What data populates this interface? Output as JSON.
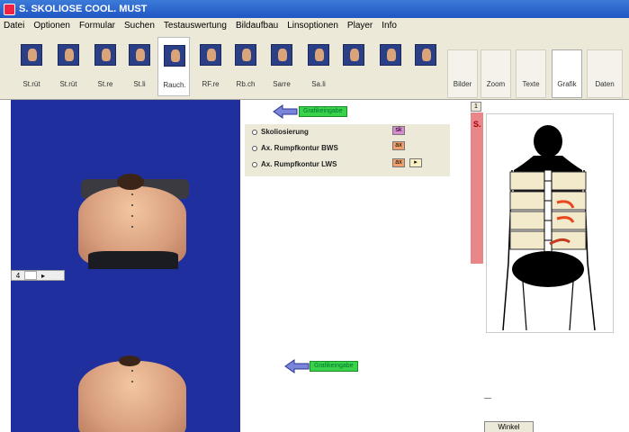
{
  "window": {
    "title": "S. SKOLIOSE COOL. MUST"
  },
  "menu": [
    "Datei",
    "Optionen",
    "Formular",
    "Suchen",
    "Testauswertung",
    "Bildaufbau",
    "Linsoptionen",
    "Player",
    "Info"
  ],
  "toolbar": {
    "pose_buttons": [
      {
        "label": "St.rüt"
      },
      {
        "label": "St.rüt"
      },
      {
        "label": "St.re"
      },
      {
        "label": "St.li"
      },
      {
        "label": "Rauch."
      },
      {
        "label": "RF.re"
      },
      {
        "label": "Rb.ch"
      },
      {
        "label": "Sarre"
      },
      {
        "label": "Sa.li"
      },
      {
        "label": ""
      },
      {
        "label": ""
      },
      {
        "label": ""
      }
    ],
    "view_buttons": [
      {
        "label": "Bilder"
      },
      {
        "label": "Zoom"
      },
      {
        "label": "Texte"
      },
      {
        "label": "Grafik"
      },
      {
        "label": "Daten"
      }
    ]
  },
  "photo_controls": {
    "labels": [
      "4",
      "",
      "▸"
    ]
  },
  "panel": {
    "rows": [
      {
        "label": "Skoliosierung",
        "chip": "sk"
      },
      {
        "label": "Ax. Rumpfkontur BWS",
        "chip": "ax"
      },
      {
        "label": "Ax. Rumpfkontur LWS",
        "chip": "ax"
      }
    ],
    "green_top": "Grafikeingabe",
    "green_bottom": "Grafikeingabe"
  },
  "right": {
    "red_label": "S.",
    "small_button": "1",
    "winkel_button": "Winkel"
  },
  "colors": {
    "titlebar": "#1f56c4",
    "photo_bg": "#1f2f9e",
    "green": "#3ad24a",
    "red_bar": "#e8868a",
    "chip_pink": "#d98ad1",
    "chip_orange": "#f0a06a"
  }
}
